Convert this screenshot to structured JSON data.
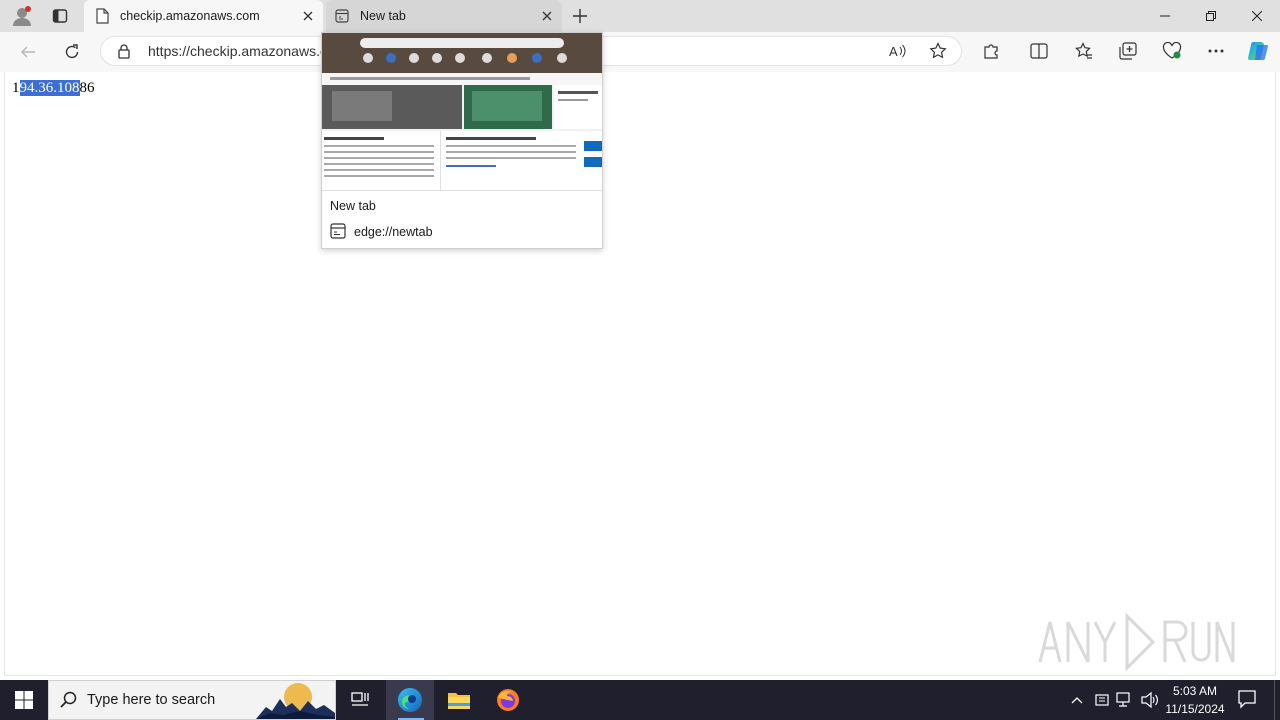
{
  "tabs": [
    {
      "title": "checkip.amazonaws.com",
      "active": true,
      "icon": "page-icon"
    },
    {
      "title": "New tab",
      "active": false,
      "icon": "newtab-icon"
    }
  ],
  "address_bar": {
    "url": "https://checkip.amazonaws.c",
    "icon": "lock-icon"
  },
  "page": {
    "ip_prefix": "1",
    "ip_selected": "94.36.108",
    "ip_suffix": "86"
  },
  "hover_card": {
    "title": "New tab",
    "url": "edge://newtab"
  },
  "taskbar": {
    "search_placeholder": "Type here to search",
    "time": "5:03 AM",
    "date": "11/15/2024"
  },
  "watermark": "ANY RUN",
  "colors": {
    "selection": "#3c6ed8",
    "taskbar": "#1f1f2e",
    "tabstrip": "#e0e0e0",
    "toolbar": "#f7f7f7"
  }
}
